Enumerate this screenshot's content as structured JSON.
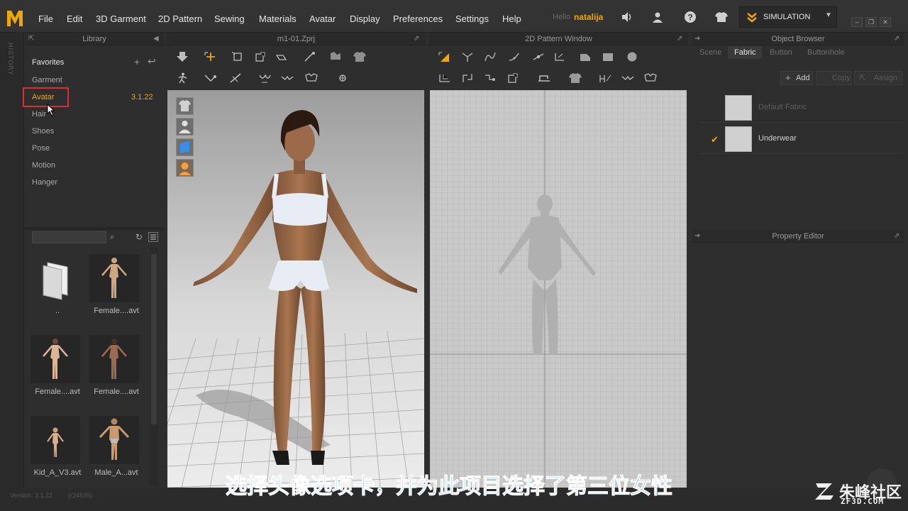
{
  "menu": {
    "items": [
      "File",
      "Edit",
      "3D Garment",
      "2D Pattern",
      "Sewing",
      "Materials",
      "Avatar",
      "Display",
      "Preferences",
      "Settings",
      "Help"
    ],
    "hello": "Hello",
    "username": "natalija",
    "simulation_label": "SIMULATION",
    "accent": "#f0a800"
  },
  "history": {
    "label": "HISTORY"
  },
  "library": {
    "title": "Library",
    "favorites_title": "Favorites",
    "items": [
      "Garment",
      "Avatar",
      "Hair",
      "Shoes",
      "Pose",
      "Motion",
      "Hanger"
    ],
    "avatar_version": "3.1.22",
    "thumbnails": [
      {
        "label": ".."
      },
      {
        "label": "Female....avt"
      },
      {
        "label": "Female....avt"
      },
      {
        "label": "Female....avt"
      },
      {
        "label": "Kid_A_V3.avt"
      },
      {
        "label": "Male_A...avt"
      }
    ]
  },
  "viewport3d": {
    "title": "m1-01.Zprj"
  },
  "viewport2d": {
    "title": "2D Pattern Window"
  },
  "object_browser": {
    "title": "Object Browser",
    "tabs": [
      "Scene",
      "Fabric",
      "Button",
      "Buttonhole"
    ],
    "active_tab": "Fabric",
    "buttons": {
      "add": "Add",
      "copy": "Copy",
      "assign": "Assign"
    },
    "fabrics": [
      {
        "name": "Default Fabric",
        "selected": false
      },
      {
        "name": "Underwear",
        "selected": true
      }
    ]
  },
  "property_editor": {
    "title": "Property Editor"
  },
  "status": {
    "version": "Version: 3.1.22",
    "build": "(r24595)"
  },
  "overlay": {
    "subtitle": "选择头像选项卡，并为此项目选择了第三位女性",
    "watermark_text": "朱峰社区",
    "watermark_sub": "ZF3D.COM"
  }
}
